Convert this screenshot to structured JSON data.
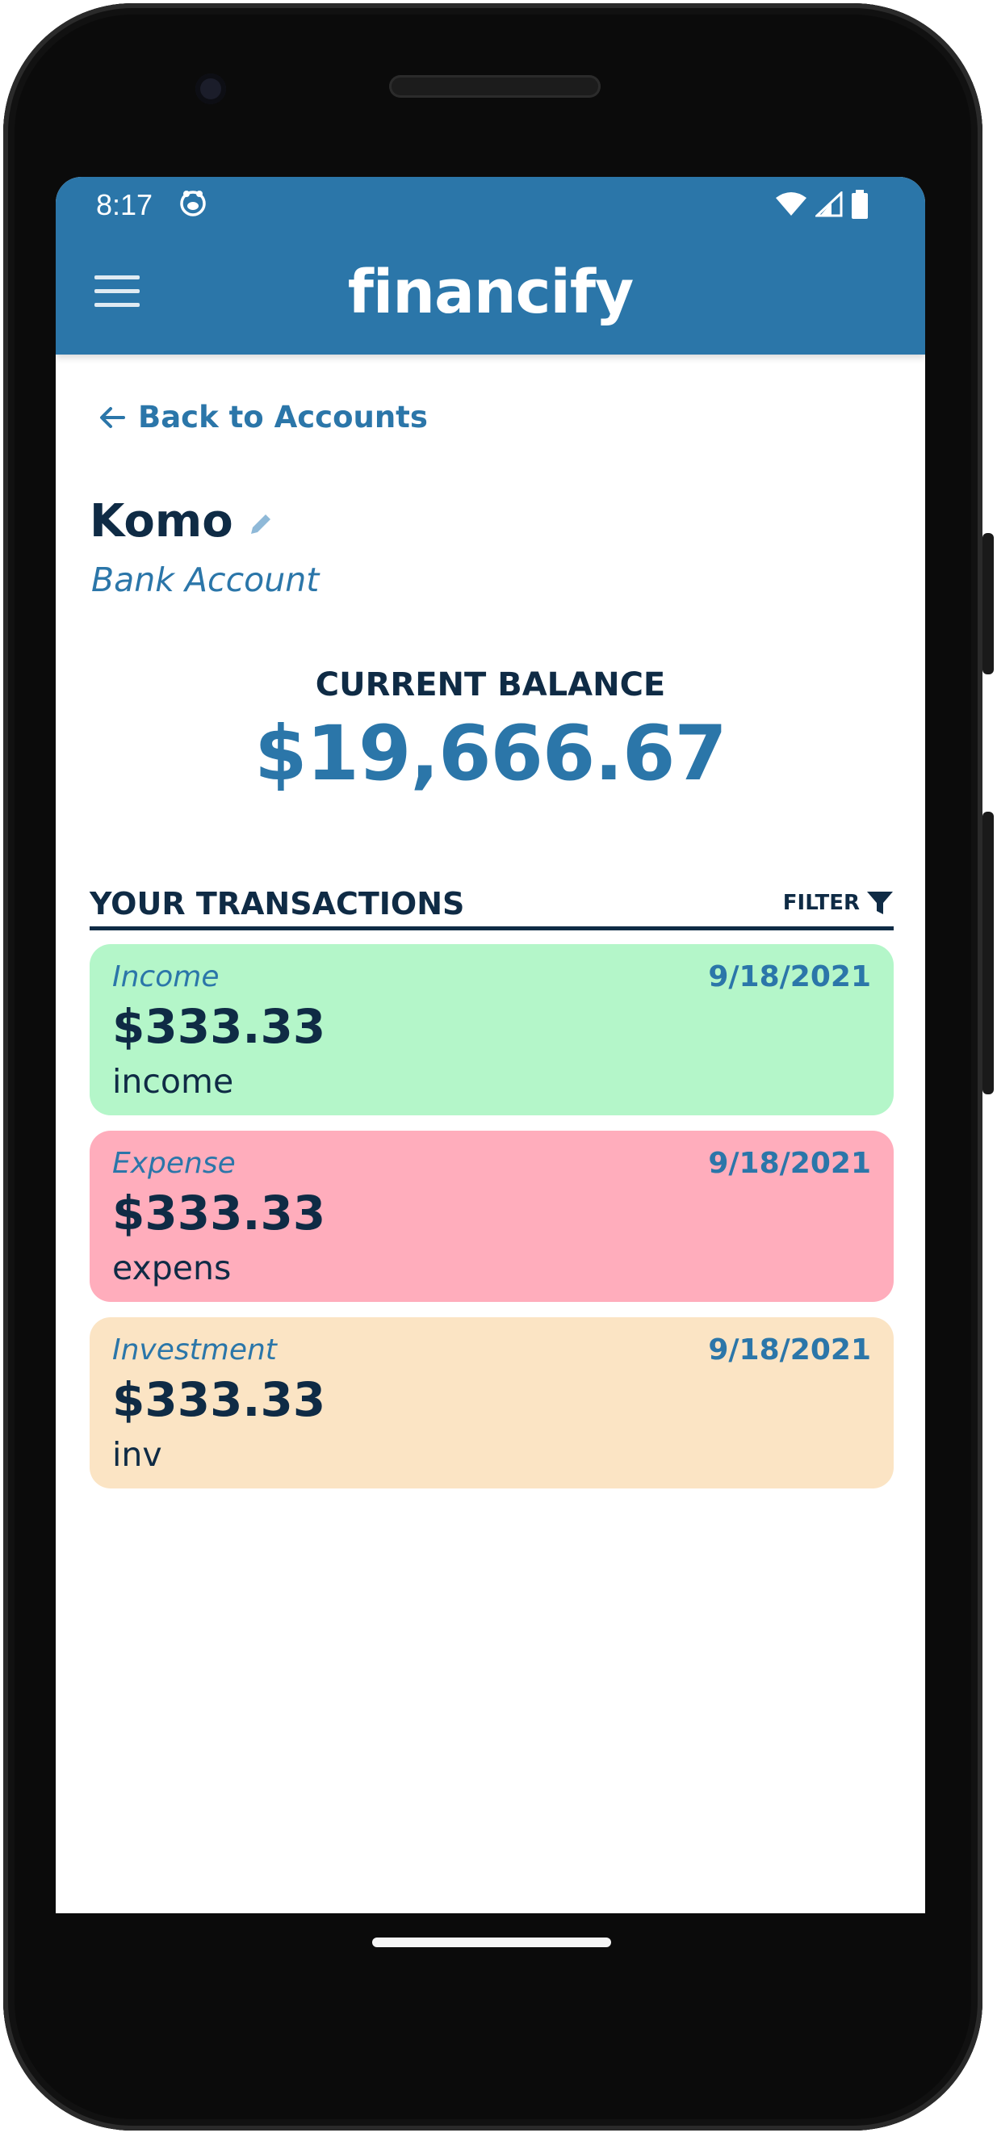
{
  "status_bar": {
    "time": "8:17"
  },
  "app": {
    "brand": "financify"
  },
  "nav": {
    "back_label": "Back to Accounts"
  },
  "account": {
    "name": "Komo",
    "type": "Bank Account"
  },
  "balance": {
    "label": "CURRENT BALANCE",
    "value": "$19,666.67"
  },
  "transactions_section": {
    "title": "YOUR TRANSACTIONS",
    "filter_label": "FILTER"
  },
  "transactions": [
    {
      "type": "Income",
      "date": "9/18/2021",
      "amount": "$333.33",
      "description": "income",
      "color": "#b4f6c9"
    },
    {
      "type": "Expense",
      "date": "9/18/2021",
      "amount": "$333.33",
      "description": "expens",
      "color": "#ffadbc"
    },
    {
      "type": "Investment",
      "date": "9/18/2021",
      "amount": "$333.33",
      "description": "inv",
      "color": "#fbe4c4"
    }
  ],
  "colors": {
    "primary": "#2b76a9",
    "dark_text": "#0f2b45"
  },
  "icons": {
    "menu": "hamburger-menu-icon",
    "back": "arrow-left-icon",
    "edit": "pencil-icon",
    "filter": "funnel-icon",
    "wifi": "wifi-icon",
    "signal": "cell-signal-icon",
    "battery": "battery-icon",
    "mascot": "app-notification-icon"
  }
}
